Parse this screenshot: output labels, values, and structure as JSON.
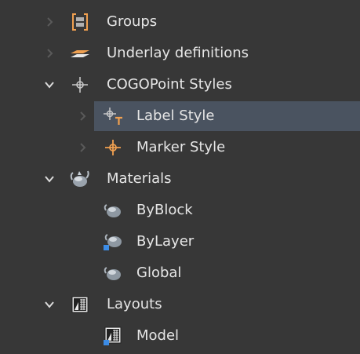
{
  "tree": {
    "groups": {
      "label": "Groups"
    },
    "underlay": {
      "label": "Underlay definitions"
    },
    "cogo": {
      "label": "COGOPoint Styles",
      "label_style": {
        "label": "Label Style"
      },
      "marker_style": {
        "label": "Marker Style"
      }
    },
    "materials": {
      "label": "Materials",
      "byblock": {
        "label": "ByBlock"
      },
      "bylayer": {
        "label": "ByLayer"
      },
      "global": {
        "label": "Global"
      }
    },
    "layouts": {
      "label": "Layouts",
      "model": {
        "label": "Model"
      }
    }
  },
  "colors": {
    "background": "#373737",
    "selection": "#4a5360",
    "text": "#e6e6e6",
    "accent_orange": "#f0a050",
    "accent_blue": "#3c8ce6"
  },
  "icons": {
    "groups": "bracket-group-icon",
    "underlay": "layer-sheet-icon",
    "cogo": "crosshair-point-icon",
    "label_style": "crosshair-text-icon",
    "marker_style": "crosshair-marker-icon",
    "materials": "teapot-icon",
    "layouts": "layout-grid-icon"
  }
}
